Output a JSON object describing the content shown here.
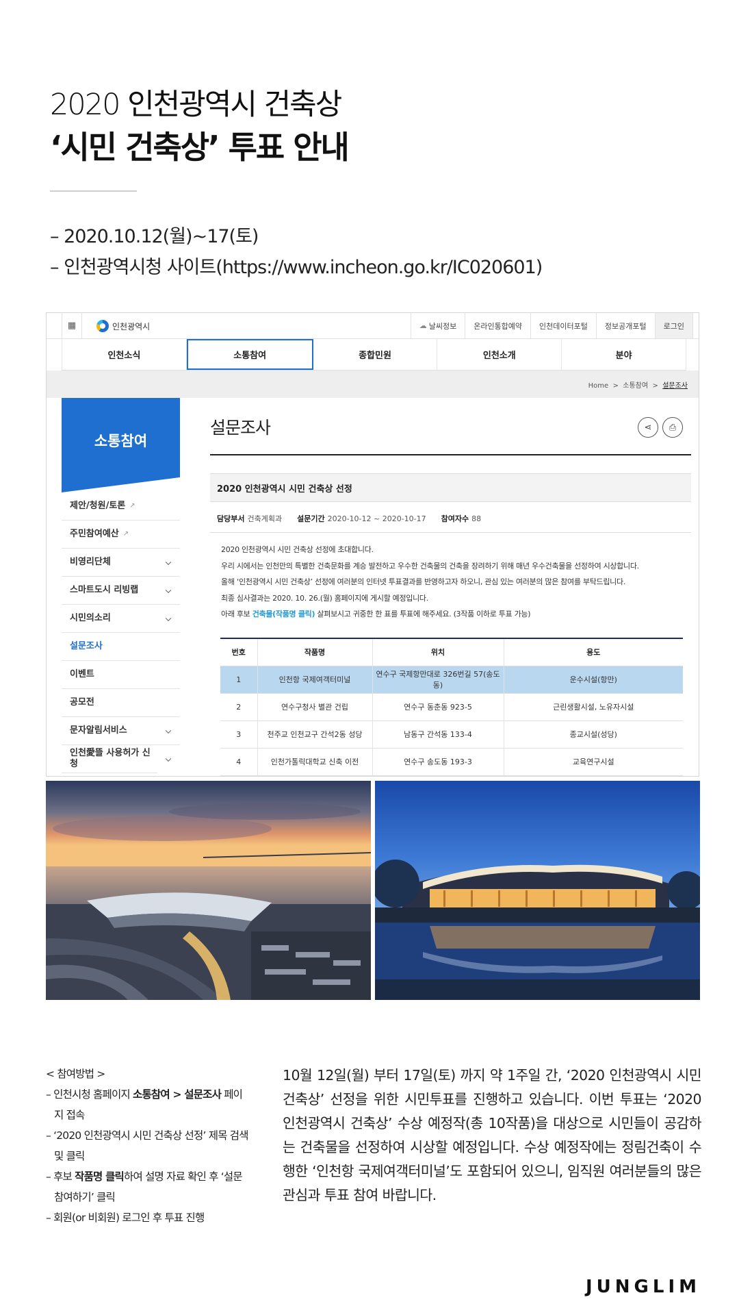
{
  "header": {
    "title_line1": "2020 인천광역시 건축상",
    "title_line2": "‘시민 건축상’ 투표 안내",
    "period": "– 2020.10.12(월)~17(토)",
    "site": "– 인천광역시청 사이트(https://www.incheon.go.kr/IC020601)"
  },
  "site": {
    "logo_text": "인천광역시",
    "util_links": [
      "날씨정보",
      "온라인통합예약",
      "인천데이터포털",
      "정보공개포털",
      "로그인"
    ],
    "gnb": [
      "인천소식",
      "소통참여",
      "종합민원",
      "인천소개",
      "분야"
    ],
    "breadcrumb": {
      "home": "Home",
      "sep1": ">",
      "section": "소통참여",
      "sep2": ">",
      "current": "설문조사"
    },
    "lnb": {
      "title": "소통참여",
      "items": [
        "제안/청원/토론",
        "주민참여예산",
        "비영리단체",
        "스마트도시 리빙랩",
        "시민의소리",
        "설문조사",
        "이벤트",
        "공모전",
        "문자알림서비스",
        "인천愛뜰 사용허가 신청"
      ]
    },
    "content": {
      "title": "설문조사",
      "survey_title": "2020 인천광역시 시민 건축상 선정",
      "meta": {
        "dept_label": "담당부서",
        "dept_value": "건축계획과",
        "period_label": "설문기간",
        "period_value": "2020-10-12 ~ 2020-10-17",
        "participants_label": "참여자수",
        "participants_value": "88"
      },
      "body": {
        "l1": "2020 인천광역시 시민 건축상 선정에 초대합니다.",
        "l2": "우리 시에서는 인천만의 특별한 건축문화를 계승 발전하고 우수한 건축물의 건축을 장려하기 위해 매년 우수건축물을 선정하여 시상합니다.",
        "l3": "올해 ‘인천광역시 시민 건축상’ 선정에 여러분의 인터넷 투표결과를 반영하고자 하오니, 관심 있는 여러분의 많은 참여를 부탁드립니다.",
        "l4": "최종 심사결과는 2020. 10. 26.(월) 홈페이지에 게시할 예정입니다.",
        "l5_pre": "아래 후보 ",
        "l5_link": "건축물(작품명 클릭)",
        "l5_post": " 살펴보시고 귀중한 한 표를 투표에 해주세요.  (3작품 이하로 투표 가능)"
      },
      "table": {
        "headers": [
          "번호",
          "작품명",
          "위치",
          "용도"
        ],
        "rows": [
          [
            "1",
            "인천항 국제여객터미널",
            "연수구 국제항만대로 326번길 57(송도동)",
            "운수시설(항만)"
          ],
          [
            "2",
            "연수구청사 별관 건립",
            "연수구 동춘동 923-5",
            "근린생활시설, 노유자시설"
          ],
          [
            "3",
            "천주교 인천교구 간석2동 성당",
            "남동구 간석동 133-4",
            "종교시설(성당)"
          ],
          [
            "4",
            "인천가톨릭대학교 신축 이전",
            "연수구 송도동 193-3",
            "교육연구시설"
          ]
        ]
      }
    }
  },
  "how": {
    "head": "< 참여방법 >",
    "l1_pre": "– 인천시청 홈페이지 ",
    "l1_b1": "소통참여 > 설문조사",
    "l1_post": " 페이지 접속",
    "l2": "– ‘2020 인천광역시 시민 건축상 선정’ 제목 검색 및 클릭",
    "l3_pre": "– 후보 ",
    "l3_b": "작품명 클릭",
    "l3_post": "하여 설명 자료 확인 후 ‘설문 참여하기’ 클릭",
    "l4": "– 회원(or 비회원) 로그인 후 투표 진행"
  },
  "description": "10월 12일(월) 부터 17일(토) 까지 약 1주일 간, ‘2020 인천광역시 시민 건축상’ 선정을 위한 시민투표를 진행하고 있습니다. 이번 투표는 ‘2020 인천광역시 건축상’ 수상 예정작(총 10작품)을 대상으로 시민들이 공감하는 건축물을 선정하여 시상할 예정입니다. 수상 예정작에는 정림건축이 수행한 ‘인천항 국제여객터미널’도 포함되어 있으니, 임직원 여러분들의 많은 관심과 투표 참여 바랍니다.",
  "brand": "JUNGLIM",
  "colors": {
    "accent": "#1e6fd0",
    "highlight_row": "#b9d7ee",
    "link": "#1e9ad6"
  }
}
